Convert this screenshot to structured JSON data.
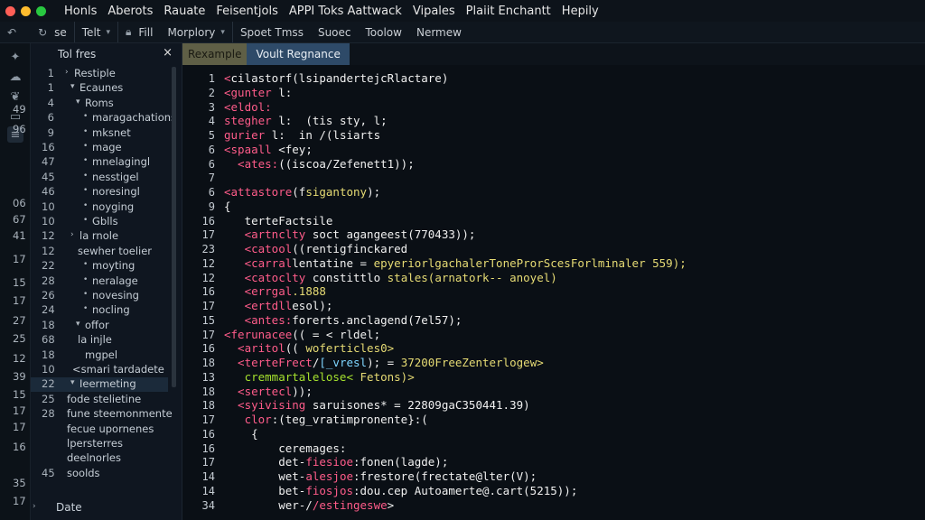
{
  "window": {
    "traffic_lights": [
      "#ff5f57",
      "#febc2e",
      "#28c840"
    ]
  },
  "menu": [
    "Honls",
    "Aberots",
    "Rauate",
    "Feisentjols",
    "APPI Toks Aattwack",
    "Vipales",
    "Plaiit Enchantt",
    "Hepily"
  ],
  "toolbar": {
    "items": [
      {
        "icon": "back-icon",
        "label": ""
      },
      {
        "icon": "refresh-icon",
        "label": "se"
      },
      {
        "icon": "",
        "label": "Telt",
        "caret": true
      },
      {
        "icon": "lock-icon",
        "label": "Fill"
      },
      {
        "icon": "",
        "label": "Morplory",
        "caret": true
      },
      {
        "icon": "",
        "label": "Spoet Tmss"
      },
      {
        "icon": "",
        "label": "Suoec"
      },
      {
        "icon": "",
        "label": "Toolow"
      },
      {
        "icon": "",
        "label": "Nermew"
      }
    ]
  },
  "explorer": {
    "title": "Tol fres",
    "close": "×",
    "tree": [
      {
        "num": "1",
        "marker": "›",
        "label": "Restiple",
        "indent": 0
      },
      {
        "num": "1",
        "marker": "▾",
        "label": "Ecaunes",
        "indent": 1
      },
      {
        "num": "4",
        "marker": "▾",
        "label": "Roms",
        "indent": 2
      },
      {
        "num": "6",
        "marker": "•",
        "label": "maragachations",
        "indent": 3
      },
      {
        "num": "9",
        "marker": "•",
        "label": "mksnet",
        "indent": 3
      },
      {
        "num": "16",
        "marker": "•",
        "label": "mage",
        "indent": 3
      },
      {
        "num": "47",
        "marker": "•",
        "label": "mnelagingl",
        "indent": 3
      },
      {
        "num": "45",
        "marker": "•",
        "label": "nesstigel",
        "indent": 3
      },
      {
        "num": "46",
        "marker": "•",
        "label": "noresingl",
        "indent": 3
      },
      {
        "num": "10",
        "marker": "•",
        "label": "noyging",
        "indent": 3
      },
      {
        "num": "10",
        "marker": "•",
        "label": "Gblls",
        "indent": 3
      },
      {
        "num": "12",
        "marker": "›",
        "label": "la rnole",
        "indent": 1
      },
      {
        "num": "12",
        "marker": "",
        "label": "sewher toelier",
        "indent": 2
      },
      {
        "num": "22",
        "marker": "•",
        "label": "moyting",
        "indent": 3
      },
      {
        "num": "28",
        "marker": "•",
        "label": "neralage",
        "indent": 3
      },
      {
        "num": "26",
        "marker": "•",
        "label": "novesing",
        "indent": 3
      },
      {
        "num": "24",
        "marker": "•",
        "label": "nocling",
        "indent": 3
      },
      {
        "num": "18",
        "marker": "▾",
        "label": "offor",
        "indent": 2
      },
      {
        "num": "68",
        "marker": "",
        "label": "la injle",
        "indent": 2
      },
      {
        "num": "18",
        "marker": "",
        "label": "mgpel",
        "indent": 3
      },
      {
        "num": "10",
        "marker": "",
        "label": "<smari tardadete",
        "indent": 1
      },
      {
        "num": "22",
        "marker": "▾",
        "label": "Ieermeting",
        "indent": 1,
        "selected": true
      },
      {
        "num": "25",
        "marker": "",
        "label": "fode stelietine",
        "indent": 0
      },
      {
        "num": "28",
        "marker": "",
        "label": "fune steemonmente",
        "indent": 0
      },
      {
        "num": "",
        "marker": "",
        "label": "fecue upornenes",
        "indent": 0
      },
      {
        "num": "",
        "marker": "",
        "label": "lpersterres",
        "indent": 0
      },
      {
        "num": "",
        "marker": "",
        "label": "deelnorles",
        "indent": 0
      },
      {
        "num": "45",
        "marker": "",
        "label": "soolds",
        "indent": 0
      }
    ],
    "footer": {
      "marker": "›",
      "label": "Date"
    }
  },
  "outer_numbers": [
    "49",
    "96",
    "06",
    "67",
    "41",
    "17",
    "15",
    "17",
    "27",
    "25",
    "12",
    "39",
    "15",
    "17",
    "17",
    "16",
    "35",
    "17"
  ],
  "tabs": [
    {
      "label": "Rexample",
      "active": false
    },
    {
      "label": "Voult Regnance",
      "active": true
    }
  ],
  "editor": {
    "lines": [
      {
        "n": "1",
        "segments": [
          {
            "t": "<",
            "c": "k"
          },
          {
            "t": "cilastorf(lsipandertejcRlactare)",
            "c": "w"
          }
        ]
      },
      {
        "n": "2",
        "segments": [
          {
            "t": "<gunter ",
            "c": "k"
          },
          {
            "t": "l:",
            "c": "w"
          }
        ]
      },
      {
        "n": "3",
        "segments": [
          {
            "t": "<eldol:",
            "c": "k"
          }
        ]
      },
      {
        "n": "4",
        "segments": [
          {
            "t": "stegher ",
            "c": "k"
          },
          {
            "t": "l:  (tis sty, l;",
            "c": "w"
          }
        ]
      },
      {
        "n": "5",
        "segments": [
          {
            "t": "gurier ",
            "c": "k"
          },
          {
            "t": "l:  in /(lsiarts",
            "c": "w"
          }
        ]
      },
      {
        "n": "6",
        "segments": [
          {
            "t": "<spaall ",
            "c": "k"
          },
          {
            "t": "<fey;",
            "c": "w"
          }
        ]
      },
      {
        "n": "6",
        "segments": [
          {
            "t": "  <ates:",
            "c": "k"
          },
          {
            "t": "((iscoa/Zefenett1));",
            "c": "w"
          }
        ]
      },
      {
        "n": "7",
        "segments": [
          {
            "t": "",
            "c": "w"
          }
        ]
      },
      {
        "n": "6",
        "segments": [
          {
            "t": "<attastore",
            "c": "k"
          },
          {
            "t": "(f",
            "c": "w"
          },
          {
            "t": "sigantony",
            "c": "y"
          },
          {
            "t": ");",
            "c": "w"
          }
        ]
      },
      {
        "n": "9",
        "segments": [
          {
            "t": "{",
            "c": "w"
          }
        ]
      },
      {
        "n": "16",
        "segments": [
          {
            "t": "   terteFactsile",
            "c": "w"
          }
        ]
      },
      {
        "n": "17",
        "segments": [
          {
            "t": "   <artnclty ",
            "c": "k"
          },
          {
            "t": "soct agangeest(770433));",
            "c": "w"
          }
        ]
      },
      {
        "n": "23",
        "segments": [
          {
            "t": "   <catool",
            "c": "k"
          },
          {
            "t": "((rentigfinckared",
            "c": "w"
          }
        ]
      },
      {
        "n": "12",
        "segments": [
          {
            "t": "   <carral",
            "c": "k"
          },
          {
            "t": "lentatine = ",
            "c": "w"
          },
          {
            "t": "epyeriorlgachalerToneProrScesForlminaler 559);",
            "c": "y"
          }
        ]
      },
      {
        "n": "12",
        "segments": [
          {
            "t": "   <catoclty ",
            "c": "k"
          },
          {
            "t": "constittlo ",
            "c": "w"
          },
          {
            "t": "stales(arnatork-- anoyel)",
            "c": "y"
          }
        ]
      },
      {
        "n": "16",
        "segments": [
          {
            "t": "   <errgal",
            "c": "k"
          },
          {
            "t": ".1888",
            "c": "y"
          }
        ]
      },
      {
        "n": "17",
        "segments": [
          {
            "t": "   <ertdll",
            "c": "k"
          },
          {
            "t": "esol);",
            "c": "w"
          }
        ]
      },
      {
        "n": "15",
        "segments": [
          {
            "t": "   <antes:",
            "c": "k"
          },
          {
            "t": "forerts.anclagend(7el57);",
            "c": "w"
          }
        ]
      },
      {
        "n": "17",
        "segments": [
          {
            "t": "<ferunacee",
            "c": "k"
          },
          {
            "t": "(( = < rldel;",
            "c": "w"
          }
        ]
      },
      {
        "n": "16",
        "segments": [
          {
            "t": "  <aritol",
            "c": "k"
          },
          {
            "t": "(( ",
            "c": "w"
          },
          {
            "t": "woferticles0>",
            "c": "y"
          }
        ]
      },
      {
        "n": "18",
        "segments": [
          {
            "t": "  <terteFrect",
            "c": "k"
          },
          {
            "t": "/",
            "c": "w"
          },
          {
            "t": "[_vresl",
            "c": "c"
          },
          {
            "t": "); = ",
            "c": "w"
          },
          {
            "t": "37200FreeZenterlogew>",
            "c": "y"
          }
        ]
      },
      {
        "n": "13",
        "segments": [
          {
            "t": "   cremmartalelose< ",
            "c": "g"
          },
          {
            "t": "Fetons)>",
            "c": "y"
          }
        ]
      },
      {
        "n": "18",
        "segments": [
          {
            "t": "  <sertecl",
            "c": "k"
          },
          {
            "t": "));",
            "c": "w"
          }
        ]
      },
      {
        "n": "18",
        "segments": [
          {
            "t": "  <syivising ",
            "c": "k"
          },
          {
            "t": "saruisones* = 22809gaC350441.39)",
            "c": "w"
          }
        ]
      },
      {
        "n": "17",
        "segments": [
          {
            "t": "   clor",
            "c": "k"
          },
          {
            "t": ":(teg_vratimpronente}:(",
            "c": "w"
          }
        ]
      },
      {
        "n": "16",
        "segments": [
          {
            "t": "    {",
            "c": "w"
          }
        ]
      },
      {
        "n": "16",
        "segments": [
          {
            "t": "        ceremages:",
            "c": "w"
          }
        ]
      },
      {
        "n": "17",
        "segments": [
          {
            "t": "        det-",
            "c": "w"
          },
          {
            "t": "fiesioe",
            "c": "k"
          },
          {
            "t": ":fonen(lagde);",
            "c": "w"
          }
        ]
      },
      {
        "n": "14",
        "segments": [
          {
            "t": "        wet-",
            "c": "w"
          },
          {
            "t": "alesjoe",
            "c": "k"
          },
          {
            "t": ":frestore(frectate@lter(V);",
            "c": "w"
          }
        ]
      },
      {
        "n": "14",
        "segments": [
          {
            "t": "        bet-",
            "c": "w"
          },
          {
            "t": "fiosjos",
            "c": "k"
          },
          {
            "t": ":dou.cep Autoamerte@.cart(5215));",
            "c": "w"
          }
        ]
      },
      {
        "n": "34",
        "segments": [
          {
            "t": "        wer-/",
            "c": "w"
          },
          {
            "t": "/estingeswe",
            "c": "k"
          },
          {
            "t": ">",
            "c": "w"
          }
        ]
      }
    ]
  }
}
